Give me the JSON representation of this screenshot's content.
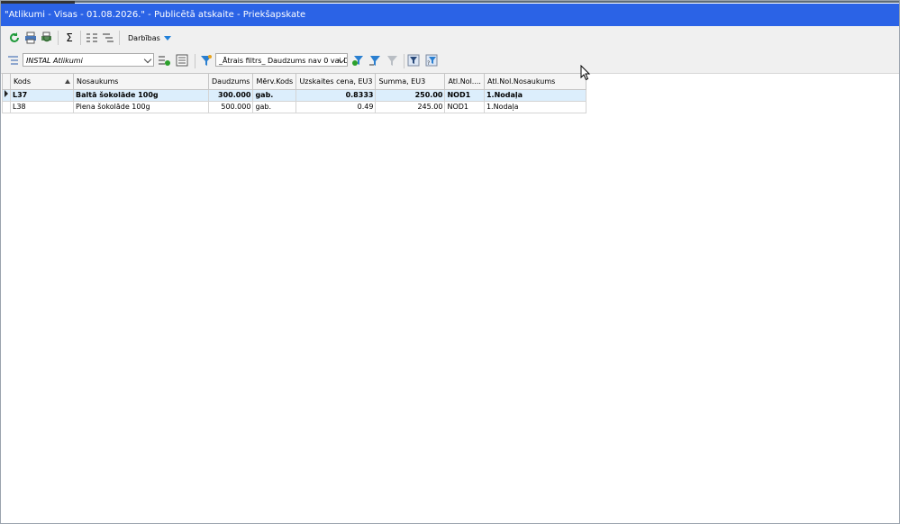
{
  "window": {
    "title": "\"Atlikumi - Visas - 01.08.2026.\" - Publicētā atskaite - Priekšapskate"
  },
  "toolbar": {
    "icons": [
      "refresh-icon",
      "print-icon",
      "print-preview-icon",
      "sum-icon",
      "columns-icon",
      "tree-icon"
    ],
    "actions_label": "Darbības"
  },
  "filterbar": {
    "layout_value": "INSTAL Atlikumi",
    "quick_filter_value": "_Ātrais filtrs_ Daudzums nav 0 vai Da"
  },
  "grid": {
    "columns": [
      "Kods",
      "Nosaukums",
      "Daudzums",
      "Mērv.Kods",
      "Uzskaites cena, EU3",
      "Summa, EU3",
      "Atl.Nol....",
      "Atl.Nol.Nosaukums"
    ],
    "rows": [
      [
        "L37",
        "Baltā šokolāde 100g",
        "300.000",
        "gab.",
        "0.8333",
        "250.00",
        "NOD1",
        "1.Nodaļa"
      ],
      [
        "L38",
        "Piena šokolāde 100g",
        "500.000",
        "gab.",
        "0.49",
        "245.00",
        "NOD1",
        "1.Nodaļa"
      ]
    ],
    "selected_row": 0
  },
  "colors": {
    "title_bar": "#2b63e6",
    "selected_row": "#dceefc",
    "toolbar_bg": "#f0f0f0"
  }
}
